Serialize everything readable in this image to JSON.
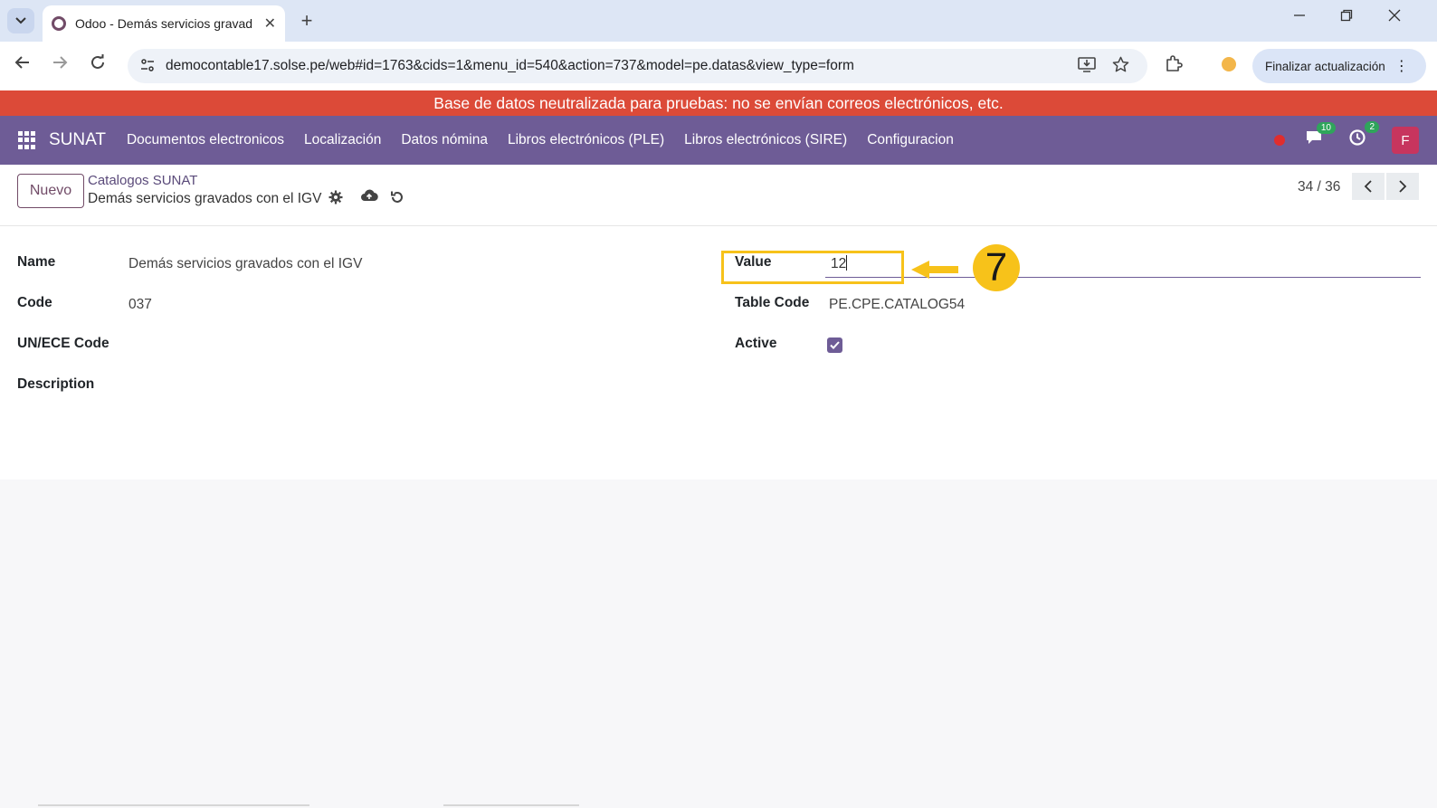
{
  "browser": {
    "tab_title": "Odoo - Demás servicios gravad",
    "tab_list_icon": "chevron-down",
    "close_tab_glyph": "✕",
    "new_tab_glyph": "+",
    "url": "democontable17.solse.pe/web#id=1763&cids=1&menu_id=540&action=737&model=pe.datas&view_type=form",
    "update_button_label": "Finalizar actualización"
  },
  "banner_text": "Base de datos neutralizada para pruebas: no se envían correos electrónicos, etc.",
  "navbar": {
    "brand": "SUNAT",
    "menu": [
      "Documentos electronicos",
      "Localización",
      "Datos nómina",
      "Libros electrónicos (PLE)",
      "Libros electrónicos (SIRE)",
      "Configuracion"
    ],
    "messages_badge": "10",
    "activities_badge": "2",
    "avatar_letter": "F"
  },
  "control_panel": {
    "new_button": "Nuevo",
    "breadcrumb_parent": "Catalogos SUNAT",
    "breadcrumb_current": "Demás servicios gravados con el IGV",
    "pager": "34 / 36"
  },
  "form": {
    "name_label": "Name",
    "name_value": "Demás servicios gravados con el IGV",
    "code_label": "Code",
    "code_value": "037",
    "unece_label": "UN/ECE Code",
    "description_label": "Description",
    "value_label": "Value",
    "value_input": "12",
    "table_code_label": "Table Code",
    "table_code_value": "PE.CPE.CATALOG54",
    "active_label": "Active",
    "active_checked": true
  },
  "annotation": {
    "step_number": "7",
    "color": "#f7c21a"
  },
  "colors": {
    "navbar": "#6e5c96",
    "banner": "#dc4a38",
    "brand_primary": "#714b67"
  }
}
